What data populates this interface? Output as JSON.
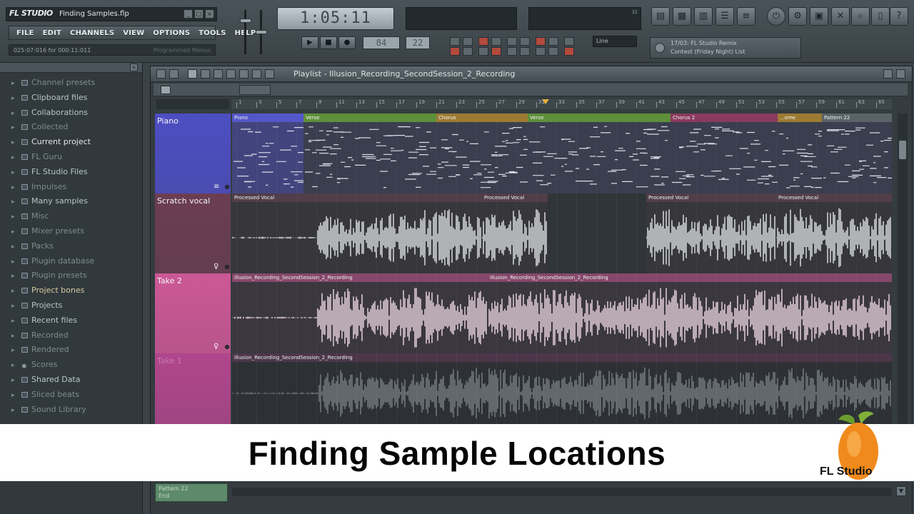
{
  "app": {
    "logo_text": "FL STUDIO",
    "file_title": "Finding Samples.flp",
    "window_controls": [
      "_",
      "□",
      "×"
    ]
  },
  "menu": [
    "FILE",
    "EDIT",
    "CHANNELS",
    "VIEW",
    "OPTIONS",
    "TOOLS",
    "HELP"
  ],
  "hint_bar": {
    "text": "025:07:016 for 000:11:011",
    "faint_text": "Programmed Menus"
  },
  "transport": {
    "time_display": "1:05:11",
    "tempo": "84",
    "pattern": "22",
    "snap": "Line",
    "monitor_readout": "32",
    "buttons": {
      "play": "▶",
      "stop": "■",
      "record": "●"
    }
  },
  "news": {
    "line1": "17/03: FL Studio Remix",
    "line2": "Contest (Friday Night) List"
  },
  "browser": {
    "items": [
      {
        "label": "Channel presets",
        "style": "dim"
      },
      {
        "label": "Clipboard files",
        "style": "normal"
      },
      {
        "label": "Collaborations",
        "style": "normal"
      },
      {
        "label": "Collected",
        "style": "dim"
      },
      {
        "label": "Current project",
        "style": "active"
      },
      {
        "label": "FL Guru",
        "style": "dim"
      },
      {
        "label": "FL Studio Files",
        "style": "normal"
      },
      {
        "label": "Impulses",
        "style": "dim"
      },
      {
        "label": "Many samples",
        "style": "normal"
      },
      {
        "label": "Misc",
        "style": "dim"
      },
      {
        "label": "Mixer presets",
        "style": "dim"
      },
      {
        "label": "Packs",
        "style": "dim"
      },
      {
        "label": "Plugin database",
        "style": "dim"
      },
      {
        "label": "Plugin presets",
        "style": "dim"
      },
      {
        "label": "Project bones",
        "style": "gold"
      },
      {
        "label": "Projects",
        "style": "normal"
      },
      {
        "label": "Recent files",
        "style": "normal"
      },
      {
        "label": "Recorded",
        "style": "dim"
      },
      {
        "label": "Rendered",
        "style": "dim"
      },
      {
        "label": "Scores",
        "style": "dim"
      },
      {
        "label": "Shared Data",
        "style": "normal"
      },
      {
        "label": "Sliced beats",
        "style": "dim"
      },
      {
        "label": "Sound Library",
        "style": "dim"
      }
    ]
  },
  "playlist": {
    "title": "Playlist - Illusion_Recording_SecondSession_2_Recording",
    "ruler_labels": [
      "1",
      "3",
      "5",
      "7",
      "9",
      "11",
      "13",
      "15",
      "17",
      "19",
      "21",
      "23",
      "25",
      "27",
      "29",
      "31",
      "33",
      "35",
      "37",
      "39",
      "41",
      "43",
      "45",
      "47",
      "49",
      "51",
      "53",
      "55",
      "57",
      "59",
      "61",
      "63",
      "65"
    ],
    "tracks": [
      {
        "name": "Piano",
        "color": "#4d4ec2",
        "body_color": "#3d3f5e"
      },
      {
        "name": "Scratch vocal",
        "color": "#6b3d53",
        "body_color": "#34393d"
      },
      {
        "name": "Take 2",
        "color": "#cc5896",
        "body_color": "#34393d"
      },
      {
        "name": "Take 1",
        "color": "#b0468c",
        "body_color": "#2e3538"
      }
    ],
    "piano_clips": [
      {
        "label": "Piano",
        "color": "#5457c9"
      },
      {
        "label": "Verse",
        "color": "#5e8f3a"
      },
      {
        "label": "Chorus",
        "color": "#9c7b33"
      },
      {
        "label": "Verse",
        "color": "#5e8f3a"
      },
      {
        "label": "Chorus 2",
        "color": "#8b3a5f"
      },
      {
        "label": "...ome",
        "color": "#9c7b33"
      },
      {
        "label": "Pattern 22",
        "color": "#5a6468"
      }
    ],
    "vocal_clips": [
      {
        "label": "Processed Vocal"
      },
      {
        "label": "Processed Vocal"
      },
      {
        "label": "Processed Vocal"
      },
      {
        "label": "Processed Vocal"
      }
    ],
    "take2_clips": [
      {
        "label": "Illusion_Recording_SecondSession_2_Recording"
      },
      {
        "label": "Illusion_Recording_SecondSession_2_Recording"
      }
    ],
    "take1_clip": {
      "label": "Illusion_Recording_SecondSession_2_Recording"
    },
    "bottom_pattern": {
      "line1": "Pattern 22",
      "line2": "End"
    }
  },
  "caption": {
    "text": "Finding Sample Locations",
    "logo_text": "FL Studio"
  }
}
